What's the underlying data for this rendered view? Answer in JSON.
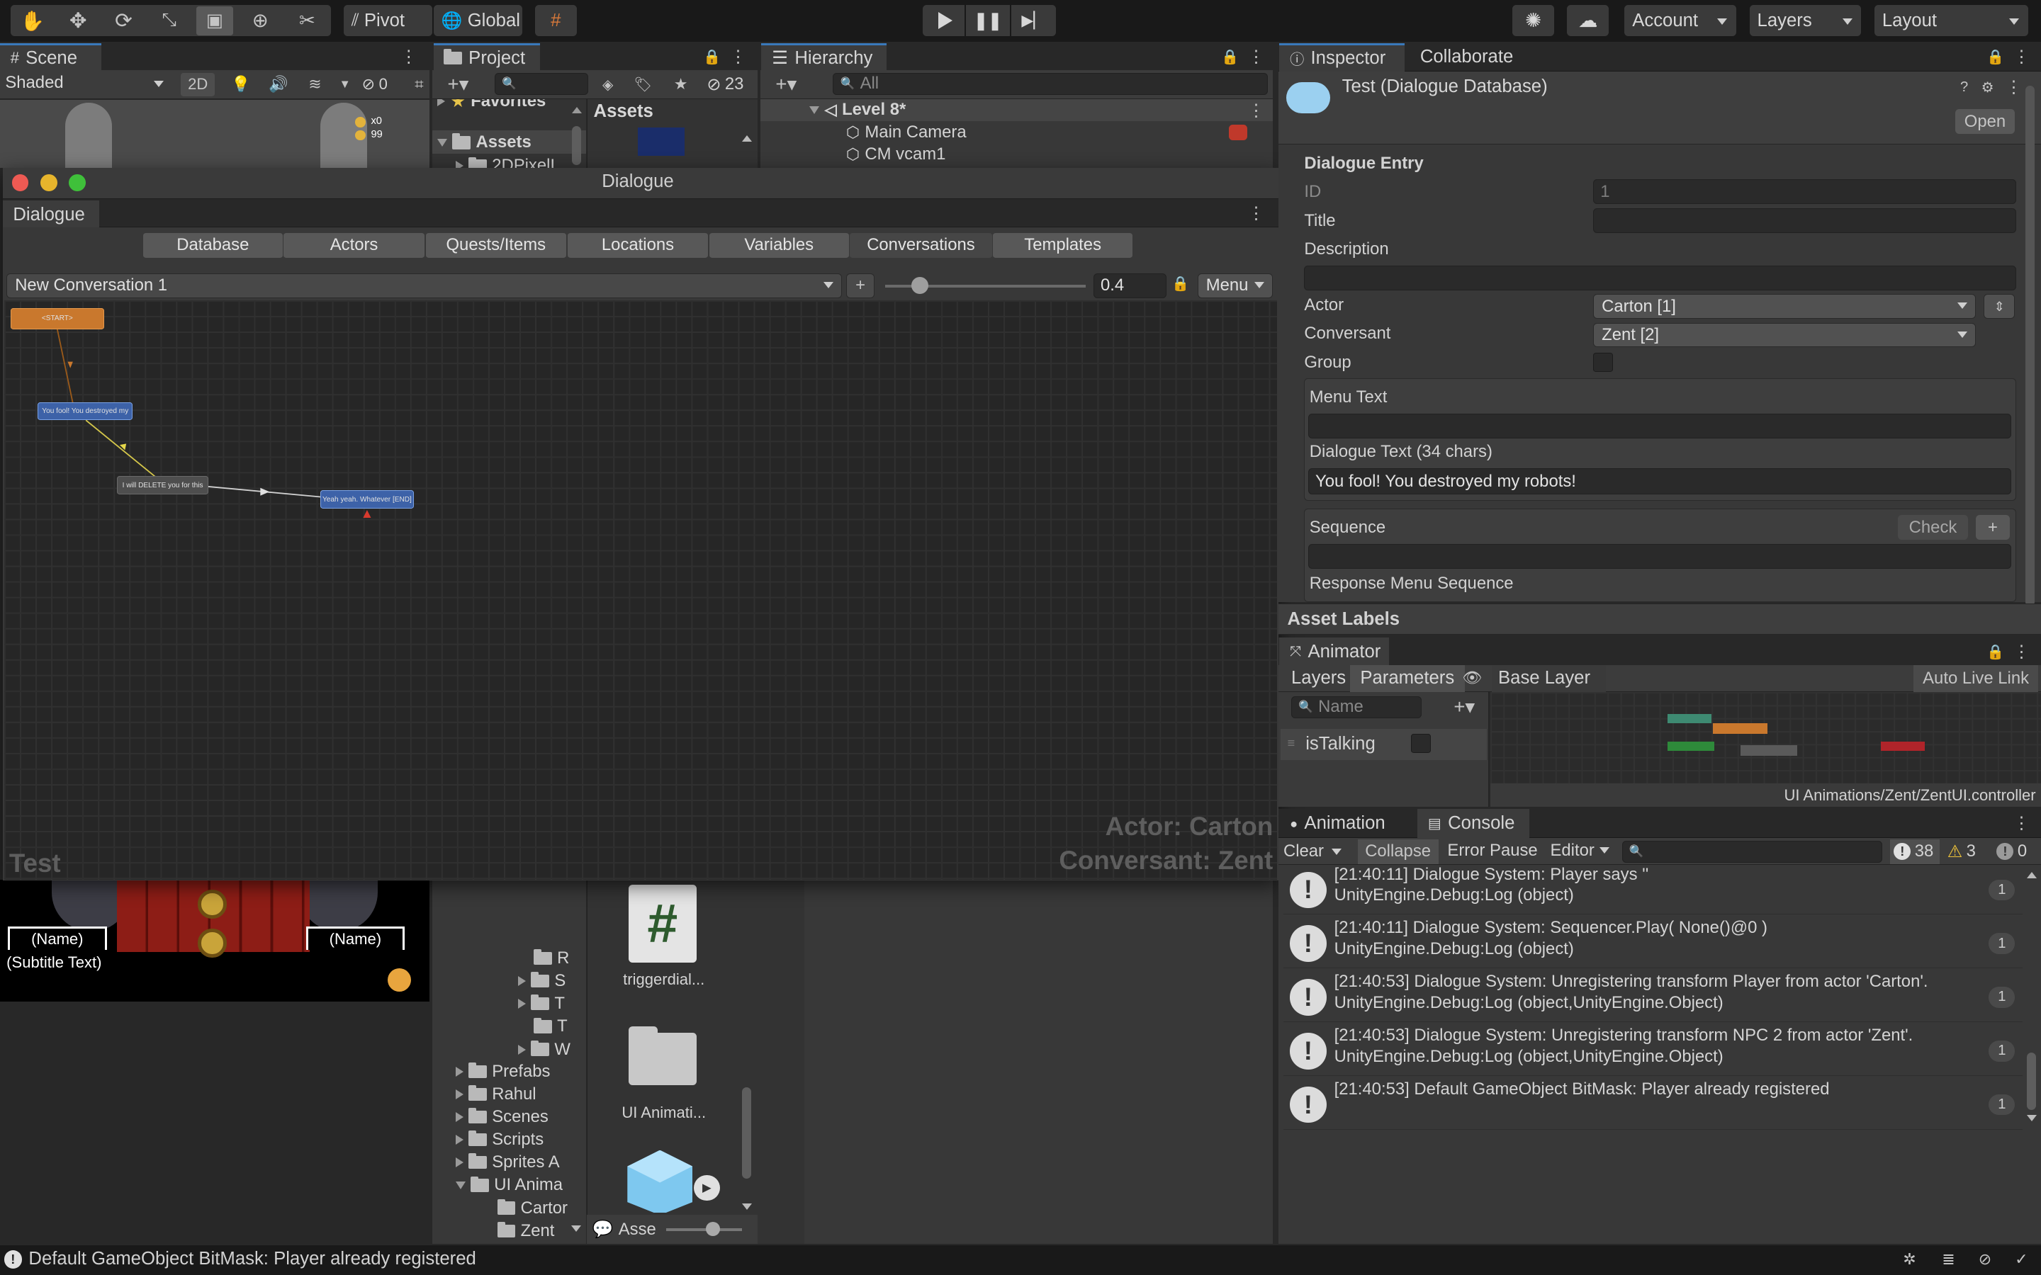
{
  "toolbar": {
    "pivot": "Pivot",
    "global": "Global",
    "account": "Account",
    "layers": "Layers",
    "layout": "Layout"
  },
  "scene": {
    "tab": "Scene",
    "shading": "Shaded",
    "mode_2d": "2D",
    "hidden_count": "0",
    "hud_x": "x0",
    "hud_y": "99",
    "name_left": "(Name)",
    "name_right": "(Name)",
    "subtitle": "(Subtitle Text)"
  },
  "project": {
    "tab": "Project",
    "favorites": "Favorites",
    "assets": "Assets",
    "assets_header": "Assets",
    "assets_child": "2DPixelI",
    "hidden_count": "23",
    "tree_partial": [
      "R",
      "S",
      "T",
      "T",
      "W"
    ],
    "tree": [
      "Prefabs",
      "Rahul",
      "Scenes",
      "Scripts",
      "Sprites A",
      "UI Anima",
      "Cartor",
      "Zent"
    ],
    "asset_items": [
      "triggerdial...",
      "UI Animati..."
    ],
    "bottom_label": "Asse"
  },
  "hierarchy": {
    "tab": "Hierarchy",
    "search_placeholder": "All",
    "scene": "Level 8*",
    "items": [
      "Main Camera",
      "CM vcam1"
    ]
  },
  "dialogue": {
    "window_title": "Dialogue",
    "tab": "Dialogue",
    "tabs": [
      "Database",
      "Actors",
      "Quests/Items",
      "Locations",
      "Variables",
      "Conversations",
      "Templates"
    ],
    "conversation": "New Conversation 1",
    "add": "+",
    "zoom": "0.4",
    "menu": "Menu",
    "nodes": {
      "start": "<START>",
      "n1": "You fool! You destroyed my",
      "n2": "I will DELETE you for this",
      "n3": "Yeah yeah. Whatever [END]"
    },
    "db_name": "Test",
    "actor": "Actor: Carton",
    "conversant": "Conversant: Zent"
  },
  "inspector": {
    "tab": "Inspector",
    "tab2": "Collaborate",
    "title": "Test (Dialogue Database)",
    "open": "Open",
    "section": "Dialogue Entry",
    "id_label": "ID",
    "id_value": "1",
    "title_label": "Title",
    "title_value": "",
    "description_label": "Description",
    "actor_label": "Actor",
    "actor_value": "Carton [1]",
    "conversant_label": "Conversant",
    "conversant_value": "Zent [2]",
    "group_label": "Group",
    "menu_text_label": "Menu Text",
    "dialogue_text_label": "Dialogue Text (34 chars)",
    "dialogue_text_value": "You fool! You destroyed my robots!",
    "sequence_label": "Sequence",
    "check": "Check",
    "plus": "+",
    "response_menu_label": "Response Menu Sequence",
    "asset_labels": "Asset Labels"
  },
  "animator": {
    "tab": "Animator",
    "layers": "Layers",
    "parameters": "Parameters",
    "base_layer": "Base Layer",
    "auto_live": "Auto Live Link",
    "search_placeholder": "Name",
    "param": "isTalking",
    "path": "UI Animations/Zent/ZentUI.controller"
  },
  "console": {
    "tab_animation": "Animation",
    "tab_console": "Console",
    "clear": "Clear",
    "collapse": "Collapse",
    "error_pause": "Error Pause",
    "editor": "Editor",
    "log_count": "38",
    "warn_count": "3",
    "err_count": "0",
    "rows": [
      {
        "line1": "[21:40:11] Dialogue System: Player says ''",
        "line2": "UnityEngine.Debug:Log (object)",
        "count": "1"
      },
      {
        "line1": "[21:40:11] Dialogue System: Sequencer.Play( None()@0 )",
        "line2": "UnityEngine.Debug:Log (object)",
        "count": "1"
      },
      {
        "line1": "[21:40:53] Dialogue System: Unregistering transform Player from actor 'Carton'.",
        "line2": "UnityEngine.Debug:Log (object,UnityEngine.Object)",
        "count": "1"
      },
      {
        "line1": "[21:40:53] Dialogue System: Unregistering transform NPC 2 from actor 'Zent'.",
        "line2": "UnityEngine.Debug:Log (object,UnityEngine.Object)",
        "count": "1"
      },
      {
        "line1": "[21:40:53] Default GameObject BitMask: Player already registered",
        "line2": "",
        "count": "1"
      }
    ]
  },
  "status": {
    "message": "Default GameObject BitMask: Player already registered"
  },
  "colors": {
    "accent": "#3a79bb",
    "start_node": "#c9782d",
    "npc_node": "#3d62a8",
    "player_node": "#5a5a5a"
  }
}
